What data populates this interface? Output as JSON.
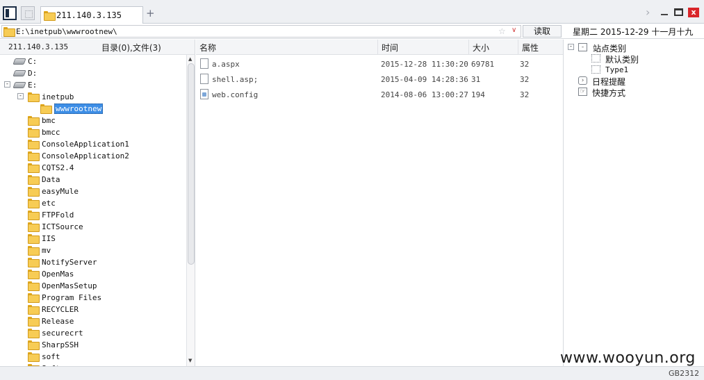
{
  "tab": {
    "label": "211.140.3.135",
    "add_label": "+"
  },
  "window": {
    "close_label": "x"
  },
  "address": {
    "path": "E:\\inetpub\\wwwrootnew\\",
    "star": "☆",
    "dropdown": "∨",
    "read_label": "读取"
  },
  "datetime": "星期二 2015-12-29 十一月十九",
  "left": {
    "host": "211.140.3.135",
    "counts": "目录(0),文件(3)"
  },
  "tree": [
    {
      "label": "C:",
      "type": "drive"
    },
    {
      "label": "D:",
      "type": "drive"
    },
    {
      "label": "E:",
      "type": "drive",
      "toggle": "-"
    },
    {
      "label": "inetpub",
      "type": "folder",
      "toggle": "-"
    },
    {
      "label": "wwwrootnew",
      "type": "folder",
      "selected": true
    },
    {
      "label": "bmc",
      "type": "folder"
    },
    {
      "label": "bmcc",
      "type": "folder"
    },
    {
      "label": "ConsoleApplication1",
      "type": "folder"
    },
    {
      "label": "ConsoleApplication2",
      "type": "folder"
    },
    {
      "label": "CQTS2.4",
      "type": "folder"
    },
    {
      "label": "Data",
      "type": "folder"
    },
    {
      "label": "easyMule",
      "type": "folder"
    },
    {
      "label": "etc",
      "type": "folder"
    },
    {
      "label": "FTPFold",
      "type": "folder"
    },
    {
      "label": "ICTSource",
      "type": "folder"
    },
    {
      "label": "IIS",
      "type": "folder"
    },
    {
      "label": "mv",
      "type": "folder"
    },
    {
      "label": "NotifyServer",
      "type": "folder"
    },
    {
      "label": "OpenMas",
      "type": "folder"
    },
    {
      "label": "OpenMasSetup",
      "type": "folder"
    },
    {
      "label": "Program Files",
      "type": "folder"
    },
    {
      "label": "RECYCLER",
      "type": "folder"
    },
    {
      "label": "Release",
      "type": "folder"
    },
    {
      "label": "securecrt",
      "type": "folder"
    },
    {
      "label": "SharpSSH",
      "type": "folder"
    },
    {
      "label": "soft",
      "type": "folder"
    },
    {
      "label": "Soft",
      "type": "folder"
    }
  ],
  "columns": {
    "name": "名称",
    "time": "时间",
    "size": "大小",
    "attr": "属性"
  },
  "files": [
    {
      "name": "a.aspx",
      "time": "2015-12-28 11:30:20",
      "size": "69781",
      "attr": "32"
    },
    {
      "name": "shell.asp;",
      "time": "2015-04-09 14:28:36",
      "size": "31",
      "attr": "32"
    },
    {
      "name": "web.config",
      "time": "2014-08-06 13:00:27",
      "size": "194",
      "attr": "32"
    }
  ],
  "right": {
    "site_category": "站点类别",
    "default_category": "默认类别",
    "type1": "Type1",
    "schedule": "日程提醒",
    "shortcuts": "快捷方式"
  },
  "watermark": "www.wooyun.org",
  "encoding": "GB2312"
}
